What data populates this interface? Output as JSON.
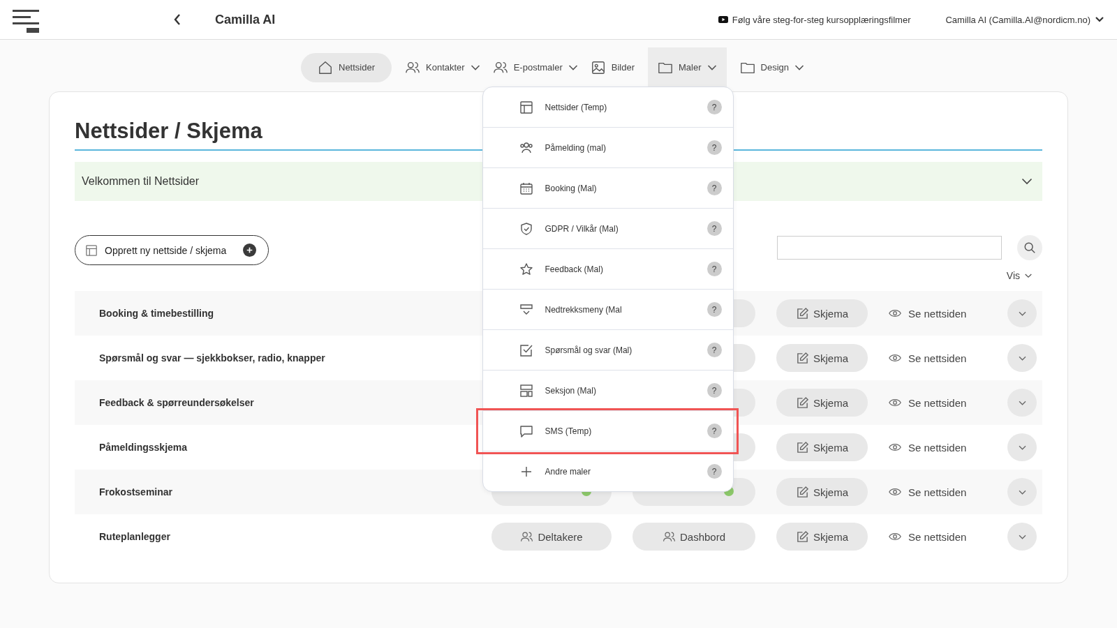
{
  "header": {
    "title": "Camilla AI",
    "tutorial_link": "Følg våre steg-for-steg kursopplæringsfilmer",
    "user": "Camilla AI (Camilla.AI@nordicm.no)"
  },
  "nav": [
    {
      "label": "Nettsider",
      "kind": "home",
      "selected": true,
      "has_menu": false,
      "expanded": false
    },
    {
      "label": "Kontakter",
      "kind": "people",
      "selected": false,
      "has_menu": true,
      "expanded": false
    },
    {
      "label": "E-postmaler",
      "kind": "people",
      "selected": false,
      "has_menu": true,
      "expanded": false
    },
    {
      "label": "Bilder",
      "kind": "image",
      "selected": false,
      "has_menu": false,
      "expanded": false
    },
    {
      "label": "Maler",
      "kind": "folder",
      "selected": false,
      "has_menu": true,
      "expanded": true
    },
    {
      "label": "Design",
      "kind": "folder",
      "selected": false,
      "has_menu": true,
      "expanded": false
    }
  ],
  "templates_menu": [
    {
      "label": "Nettsider (Temp)",
      "kind": "layout",
      "help": "?",
      "highlighted": false
    },
    {
      "label": "Påmelding (mal)",
      "kind": "group",
      "help": "?",
      "highlighted": false
    },
    {
      "label": "Booking (Mal)",
      "kind": "calendar",
      "help": "?",
      "highlighted": false
    },
    {
      "label": "GDPR / Vilkår (Mal)",
      "kind": "shield",
      "help": "?",
      "highlighted": false
    },
    {
      "label": "Feedback (Mal)",
      "kind": "star",
      "help": "?",
      "highlighted": false
    },
    {
      "label": "Nedtrekksmeny (Mal",
      "kind": "dropdown",
      "help": "?",
      "highlighted": false
    },
    {
      "label": "Spørsmål og svar (Mal)",
      "kind": "checkbox",
      "help": "?",
      "highlighted": false
    },
    {
      "label": "Seksjon (Mal)",
      "kind": "sections",
      "help": "?",
      "highlighted": false
    },
    {
      "label": "SMS (Temp)",
      "kind": "chat",
      "help": "?",
      "highlighted": true
    },
    {
      "label": "Andre maler",
      "kind": "plus",
      "help": "?",
      "highlighted": false
    }
  ],
  "page": {
    "title": "Nettsider / Skjema",
    "welcome": {
      "label": "Velkommen til Nettsider",
      "expanded": false
    },
    "create_button": "Opprett ny nettside / skjema",
    "view_menu": "Vis"
  },
  "rows": [
    {
      "name": "Booking & timebestilling",
      "form": "Skjema",
      "view": "Se nettsiden"
    },
    {
      "name": "Spørsmål og svar — sjekkbokser, radio, knapper",
      "form": "Skjema",
      "view": "Se nettsiden"
    },
    {
      "name": "Feedback & spørreundersøkelser",
      "form": "Skjema",
      "view": "Se nettsiden"
    },
    {
      "name": "Påmeldingsskjema",
      "form": "Skjema",
      "view": "Se nettsiden"
    },
    {
      "name": "Frokostseminar",
      "participants": {
        "color": "#8cc86a"
      },
      "dashboard": {
        "color": "#8cc86a"
      },
      "form": "Skjema",
      "view": "Se nettsiden"
    },
    {
      "name": "Ruteplanlegger",
      "participants": {
        "label": "Deltakere"
      },
      "dashboard": {
        "label": "Dashbord"
      },
      "form": "Skjema",
      "view": "Se nettsiden"
    }
  ]
}
